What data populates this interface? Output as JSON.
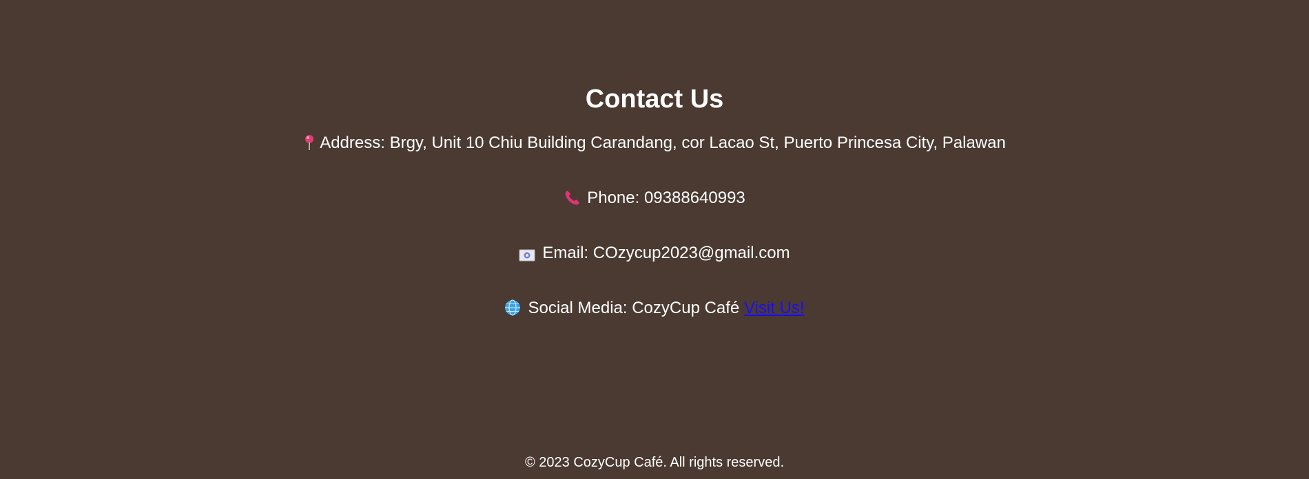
{
  "contact": {
    "title": "Contact Us",
    "address": {
      "icon": "pin-icon",
      "text": "Address: Brgy, Unit 10 Chiu Building Carandang, cor Lacao St, Puerto Princesa City, Palawan"
    },
    "phone": {
      "icon": "phone-icon",
      "text": "Phone: 09388640993"
    },
    "email": {
      "icon": "email-icon",
      "text": "Email: COzycup2023@gmail.com"
    },
    "social": {
      "icon": "globe-icon",
      "text": "Social Media: CozyCup Café",
      "link_label": "Visit Us!"
    }
  },
  "footer": {
    "text": "© 2023 CozyCup Café. All rights reserved."
  },
  "colors": {
    "background": "#4b3a31",
    "text": "#ffffff",
    "link": "#1a0dff"
  }
}
